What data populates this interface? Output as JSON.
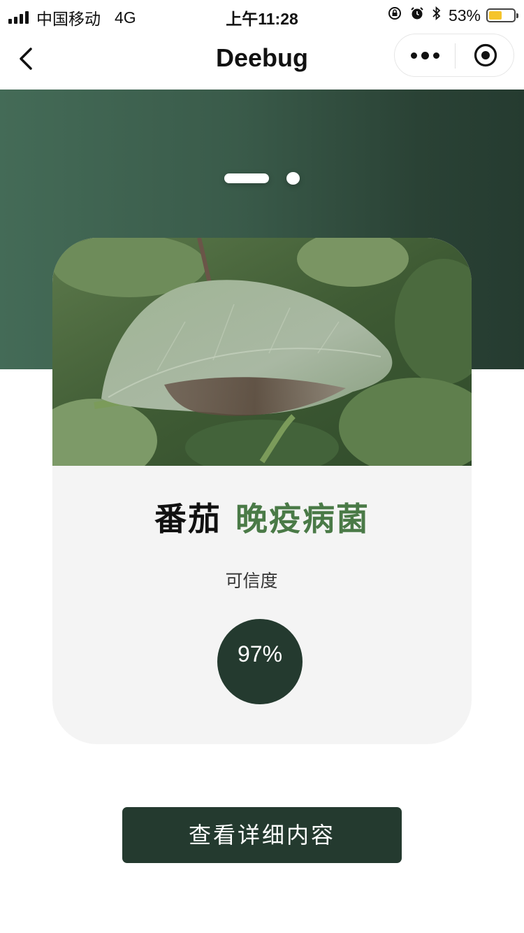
{
  "status_bar": {
    "carrier": "中国移动",
    "network": "4G",
    "time": "上午11:28",
    "battery_percent": "53%",
    "battery_level": 0.53,
    "battery_color": "#f5c42b"
  },
  "nav": {
    "title": "Deebug"
  },
  "carousel": {
    "page_count": 2,
    "active_index": 0
  },
  "result": {
    "crop": "番茄",
    "disease": "晚疫病菌",
    "confidence_label": "可信度",
    "confidence": "97%",
    "disease_color": "#4a7a47"
  },
  "actions": {
    "detail_button": "查看详细内容"
  },
  "colors": {
    "hero_dark": "#253b30",
    "hero_light": "#446b57",
    "button_bg": "#243a2f",
    "card_bg": "#f4f4f4"
  }
}
